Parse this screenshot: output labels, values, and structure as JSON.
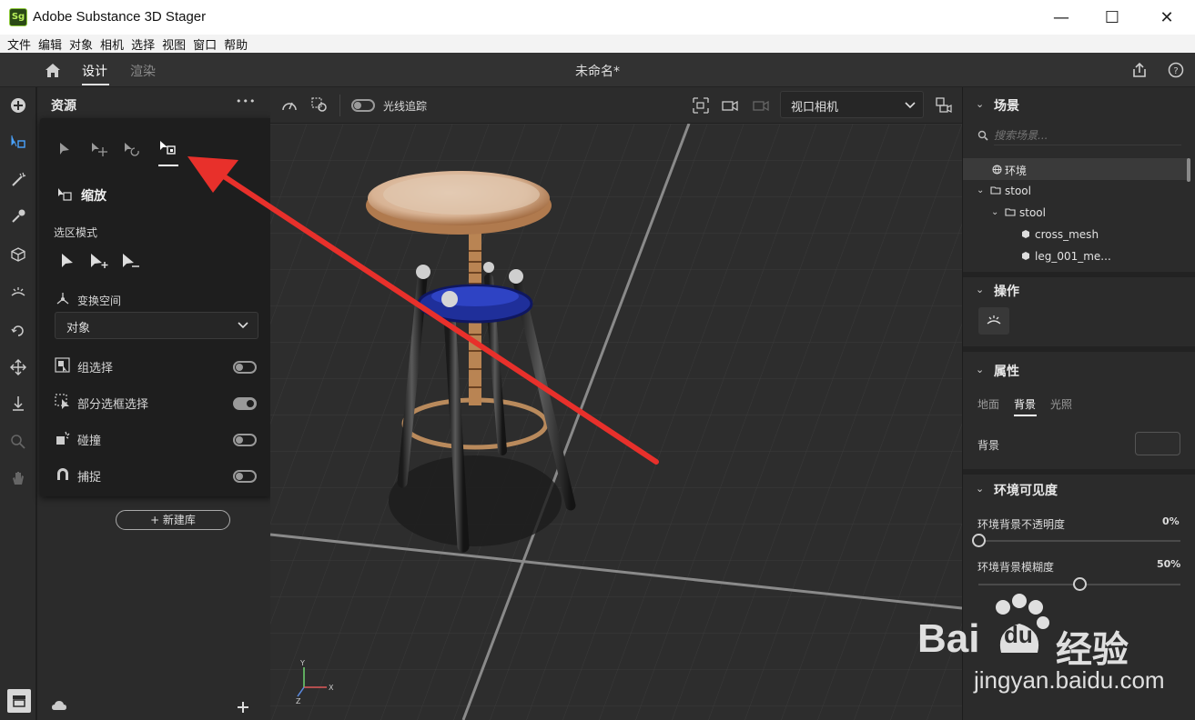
{
  "app": {
    "logo": "Sg",
    "title": "Adobe Substance 3D Stager"
  },
  "window_controls": {
    "minimize": "—",
    "maximize": "☐",
    "close": "✕"
  },
  "menu": [
    "文件",
    "编辑",
    "对象",
    "相机",
    "选择",
    "视图",
    "窗口",
    "帮助"
  ],
  "workspace": {
    "tabs": [
      "设计",
      "渲染"
    ],
    "active_tab": "设计",
    "document_title": "未命名*"
  },
  "assets_panel": {
    "title": "资源",
    "more": "•••",
    "new_library_button": "+ 新建库"
  },
  "select_popover": {
    "tool_title": "缩放",
    "selection_mode_label": "选区模式",
    "transform_space_label": "变换空间",
    "transform_space_value": "对象",
    "options": [
      {
        "label": "组选择",
        "on": false
      },
      {
        "label": "部分选框选择",
        "on": true
      },
      {
        "label": "碰撞",
        "on": false
      },
      {
        "label": "捕捉",
        "on": false
      }
    ]
  },
  "viewport_toolbar": {
    "raytrace_label": "光线追踪",
    "raytrace_on": false,
    "camera_select": "视口相机"
  },
  "axis_gizmo": {
    "y": "Y",
    "x": "X",
    "z": "Z"
  },
  "scene_panel": {
    "title": "场景",
    "search_placeholder": "搜索场景...",
    "tree": [
      {
        "label": "环境",
        "icon": "globe-icon",
        "depth": 0
      },
      {
        "label": "stool",
        "icon": "folder-icon",
        "depth": 0
      },
      {
        "label": "stool",
        "icon": "folder-icon",
        "depth": 1
      },
      {
        "label": "cross_mesh",
        "icon": "mesh-icon",
        "depth": 2
      },
      {
        "label": "leg_001_me...",
        "icon": "mesh-icon",
        "depth": 2
      }
    ]
  },
  "actions_panel": {
    "title": "操作"
  },
  "properties_panel": {
    "title": "属性",
    "tabs": [
      "地面",
      "背景",
      "光照"
    ],
    "active_tab": "背景",
    "background_label": "背景",
    "env_visibility_title": "环境可见度",
    "sliders": [
      {
        "label": "环境背景不透明度",
        "value_text": "0%",
        "value": 0
      },
      {
        "label": "环境背景模糊度",
        "value_text": "50%",
        "value": 50
      }
    ]
  },
  "watermark": {
    "brand": "Bai",
    "brand2": "du",
    "cn": "经验",
    "url": "jingyan.baidu.com"
  },
  "colors": {
    "annotation_arrow": "#e8302b",
    "accent_toggle": "#9a9a9a",
    "panel_bg": "#2b2b2b"
  }
}
